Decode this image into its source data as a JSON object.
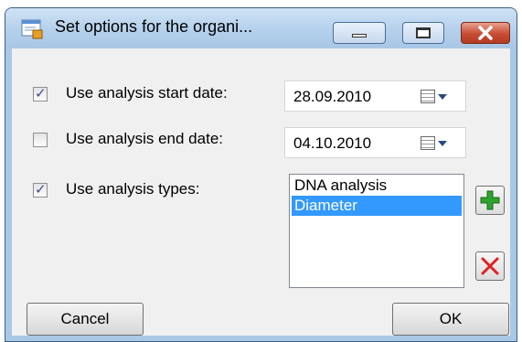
{
  "window": {
    "title": "Set options for the organi...",
    "icons": {
      "app": "window-form-icon",
      "minimize": "minimize-icon",
      "maximize": "maximize-icon",
      "close": "close-icon"
    }
  },
  "options": {
    "start_date": {
      "label": "Use analysis start date:",
      "checked": true,
      "value": "28.09.2010"
    },
    "end_date": {
      "label": "Use analysis end date:",
      "checked": false,
      "value": "04.10.2010"
    },
    "types": {
      "label": "Use analysis types:",
      "checked": true
    }
  },
  "analysis_types": {
    "items": [
      {
        "label": "DNA analysis",
        "selected": false
      },
      {
        "label": "Diameter",
        "selected": true
      }
    ]
  },
  "buttons": {
    "add_icon": "plus-icon",
    "remove_icon": "red-x-icon",
    "cancel": "Cancel",
    "ok": "OK"
  },
  "colors": {
    "selection": "#3399ff",
    "add": "#2ea32e",
    "remove": "#e02020"
  }
}
